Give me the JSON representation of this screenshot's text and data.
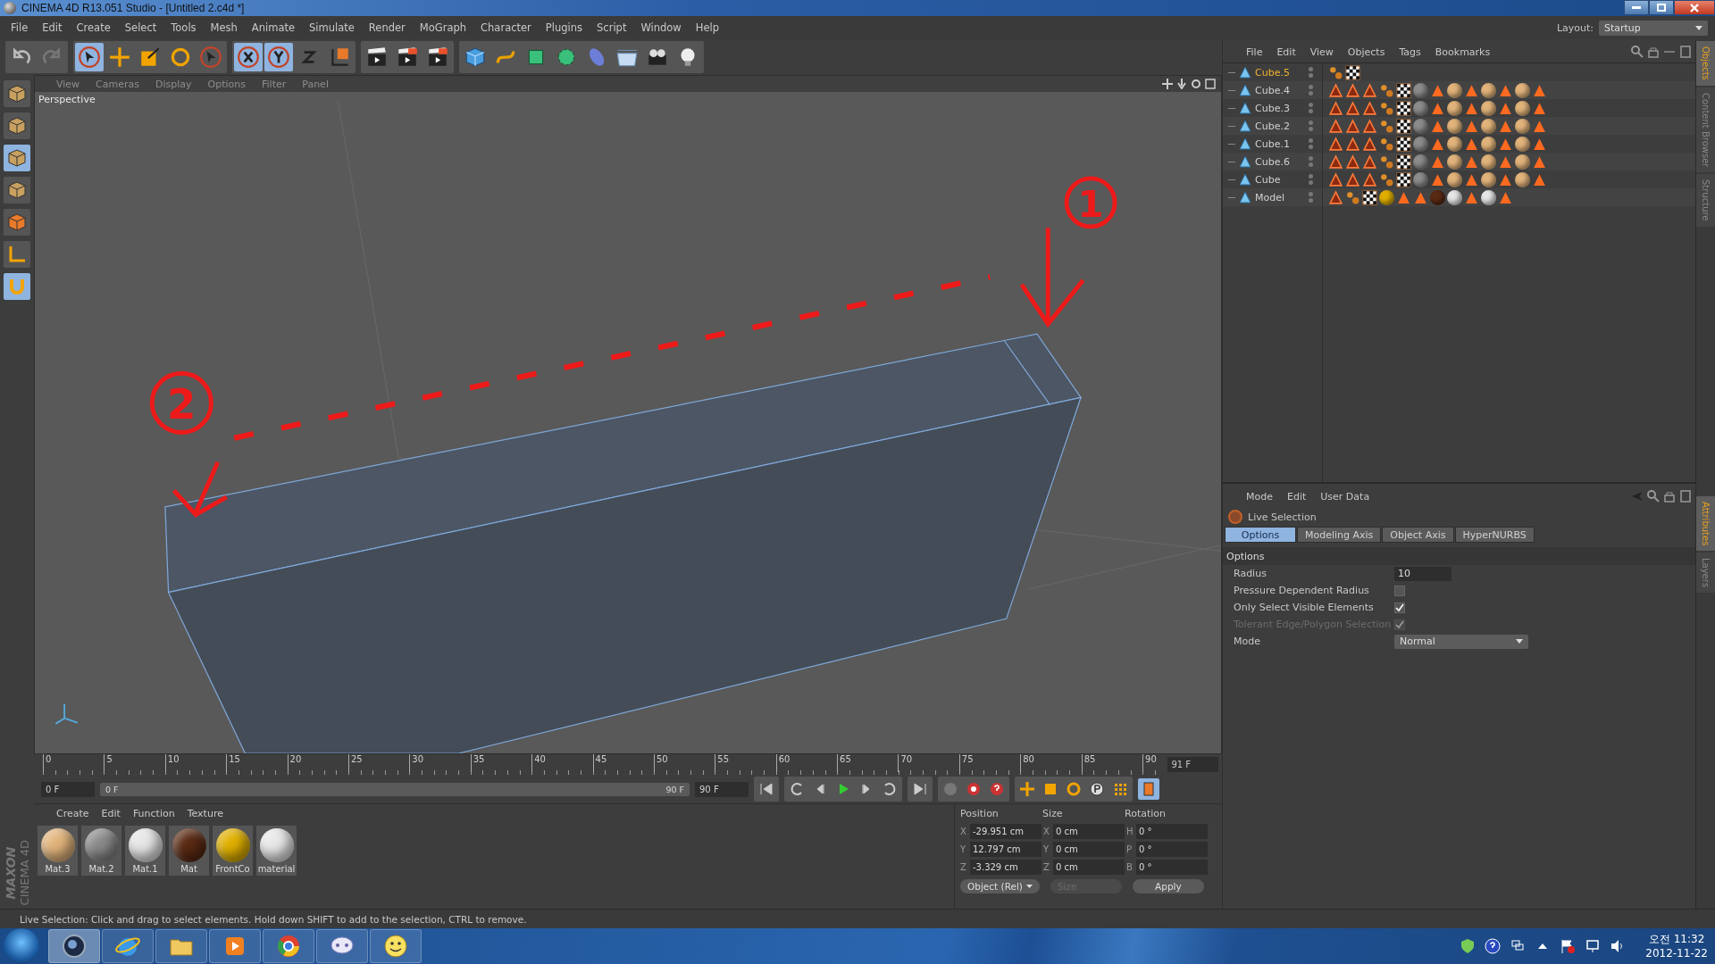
{
  "window": {
    "title": "CINEMA 4D R13.051 Studio - [Untitled 2.c4d *]"
  },
  "menu": [
    "File",
    "Edit",
    "Create",
    "Select",
    "Tools",
    "Mesh",
    "Animate",
    "Simulate",
    "Render",
    "MoGraph",
    "Character",
    "Plugins",
    "Script",
    "Window",
    "Help"
  ],
  "layout": {
    "label": "Layout:",
    "value": "Startup"
  },
  "toolbar": [
    [
      {
        "kind": "undo",
        "selected": false
      },
      {
        "kind": "redo",
        "selected": false
      }
    ],
    [
      {
        "kind": "select",
        "selected": true
      },
      {
        "kind": "move",
        "selected": false
      },
      {
        "kind": "scale",
        "selected": false
      },
      {
        "kind": "rotate",
        "selected": false
      },
      {
        "kind": "recent",
        "selected": false
      }
    ],
    [
      {
        "kind": "x",
        "selected": true
      },
      {
        "kind": "y",
        "selected": true
      },
      {
        "kind": "z",
        "selected": false
      },
      {
        "kind": "coord",
        "selected": false
      }
    ],
    [
      {
        "kind": "render",
        "selected": false
      },
      {
        "kind": "render-view",
        "selected": false
      },
      {
        "kind": "render-settings",
        "selected": false
      }
    ],
    [
      {
        "kind": "cube",
        "selected": false
      },
      {
        "kind": "spline",
        "selected": false
      },
      {
        "kind": "nurbs",
        "selected": false
      },
      {
        "kind": "array",
        "selected": false
      },
      {
        "kind": "deformer",
        "selected": false
      },
      {
        "kind": "floor",
        "selected": false
      },
      {
        "kind": "camera",
        "selected": false
      },
      {
        "kind": "light",
        "selected": false
      }
    ]
  ],
  "viewport": {
    "menu": [
      "View",
      "Cameras",
      "Display",
      "Options",
      "Filter",
      "Panel"
    ],
    "label": "Perspective",
    "annotations": [
      "1",
      "2"
    ]
  },
  "timeline": {
    "ticks": [
      "0",
      "5",
      "10",
      "15",
      "20",
      "25",
      "30",
      "35",
      "40",
      "45",
      "50",
      "55",
      "60",
      "65",
      "70",
      "75",
      "80",
      "85",
      "90"
    ],
    "end_frame": "91 F",
    "start_field": "0 F",
    "range": {
      "start": "0 F",
      "end": "90 F",
      "level": 1
    },
    "end_field": "90 F"
  },
  "materials": {
    "menu": [
      "Create",
      "Edit",
      "Function",
      "Texture"
    ],
    "items": [
      {
        "name": "Mat.3",
        "color": "#e2b47c"
      },
      {
        "name": "Mat.2",
        "color": "#8a8a8a"
      },
      {
        "name": "Mat.1",
        "color": "#e6e6e6"
      },
      {
        "name": "Mat",
        "color": "#5a2a14"
      },
      {
        "name": "FrontCo",
        "color": "#e0b000"
      },
      {
        "name": "material",
        "color": "#e8e8e8"
      }
    ]
  },
  "brand": {
    "company": "MAXON",
    "product": "CINEMA 4D"
  },
  "coordinates": {
    "headers": [
      "Position",
      "Size",
      "Rotation"
    ],
    "rows": [
      {
        "axis": "X",
        "position": "-29.951 cm",
        "size_axis": "X",
        "size": "0 cm",
        "rot_axis": "H",
        "rotation": "0 °"
      },
      {
        "axis": "Y",
        "position": "12.797 cm",
        "size_axis": "Y",
        "size": "0 cm",
        "rot_axis": "P",
        "rotation": "0 °"
      },
      {
        "axis": "Z",
        "position": "-3.329 cm",
        "size_axis": "Z",
        "size": "0 cm",
        "rot_axis": "B",
        "rotation": "0 °"
      }
    ],
    "mode": "Object (Rel)",
    "size_mode": {
      "label": "Size",
      "disabled": true
    },
    "apply": "Apply"
  },
  "objects": {
    "menu": [
      "File",
      "Edit",
      "View",
      "Objects",
      "Tags",
      "Bookmarks"
    ],
    "rows": [
      {
        "name": "Cube.5",
        "selected": true,
        "tags": [
          {
            "kind": "phong"
          },
          {
            "kind": "uvw"
          }
        ]
      },
      {
        "name": "Cube.4",
        "selected": false,
        "tags": [
          {
            "kind": "selection"
          },
          {
            "kind": "selection"
          },
          {
            "kind": "selection"
          },
          {
            "kind": "phong"
          },
          {
            "kind": "uvw"
          },
          {
            "kind": "texture",
            "color": "#8c8c8c"
          },
          {
            "kind": "cone"
          },
          {
            "kind": "texture",
            "color": "#e2b47c"
          },
          {
            "kind": "cone"
          },
          {
            "kind": "texture",
            "color": "#e2b47c"
          },
          {
            "kind": "cone"
          },
          {
            "kind": "texture",
            "color": "#e2b47c"
          },
          {
            "kind": "cone"
          }
        ]
      },
      {
        "name": "Cube.3",
        "selected": false,
        "tags": [
          {
            "kind": "selection"
          },
          {
            "kind": "selection"
          },
          {
            "kind": "selection"
          },
          {
            "kind": "phong"
          },
          {
            "kind": "uvw"
          },
          {
            "kind": "texture",
            "color": "#8c8c8c"
          },
          {
            "kind": "cone"
          },
          {
            "kind": "texture",
            "color": "#e2b47c"
          },
          {
            "kind": "cone"
          },
          {
            "kind": "texture",
            "color": "#e2b47c"
          },
          {
            "kind": "cone"
          },
          {
            "kind": "texture",
            "color": "#e2b47c"
          },
          {
            "kind": "cone"
          }
        ]
      },
      {
        "name": "Cube.2",
        "selected": false,
        "tags": [
          {
            "kind": "selection"
          },
          {
            "kind": "selection"
          },
          {
            "kind": "selection"
          },
          {
            "kind": "phong"
          },
          {
            "kind": "uvw"
          },
          {
            "kind": "texture",
            "color": "#8c8c8c"
          },
          {
            "kind": "cone"
          },
          {
            "kind": "texture",
            "color": "#e2b47c"
          },
          {
            "kind": "cone"
          },
          {
            "kind": "texture",
            "color": "#e2b47c"
          },
          {
            "kind": "cone"
          },
          {
            "kind": "texture",
            "color": "#e2b47c"
          },
          {
            "kind": "cone"
          }
        ]
      },
      {
        "name": "Cube.1",
        "selected": false,
        "tags": [
          {
            "kind": "selection"
          },
          {
            "kind": "selection"
          },
          {
            "kind": "selection"
          },
          {
            "kind": "phong"
          },
          {
            "kind": "uvw"
          },
          {
            "kind": "texture",
            "color": "#8c8c8c"
          },
          {
            "kind": "cone"
          },
          {
            "kind": "texture",
            "color": "#e2b47c"
          },
          {
            "kind": "cone"
          },
          {
            "kind": "texture",
            "color": "#e2b47c"
          },
          {
            "kind": "cone"
          },
          {
            "kind": "texture",
            "color": "#e2b47c"
          },
          {
            "kind": "cone"
          }
        ]
      },
      {
        "name": "Cube.6",
        "selected": false,
        "tags": [
          {
            "kind": "selection"
          },
          {
            "kind": "selection"
          },
          {
            "kind": "selection"
          },
          {
            "kind": "phong"
          },
          {
            "kind": "uvw"
          },
          {
            "kind": "texture",
            "color": "#8c8c8c"
          },
          {
            "kind": "cone"
          },
          {
            "kind": "texture",
            "color": "#e2b47c"
          },
          {
            "kind": "cone"
          },
          {
            "kind": "texture",
            "color": "#e2b47c"
          },
          {
            "kind": "cone"
          },
          {
            "kind": "texture",
            "color": "#e2b47c"
          },
          {
            "kind": "cone"
          }
        ]
      },
      {
        "name": "Cube",
        "selected": false,
        "tags": [
          {
            "kind": "selection"
          },
          {
            "kind": "selection"
          },
          {
            "kind": "selection"
          },
          {
            "kind": "phong"
          },
          {
            "kind": "uvw"
          },
          {
            "kind": "texture",
            "color": "#8c8c8c"
          },
          {
            "kind": "cone"
          },
          {
            "kind": "texture",
            "color": "#e2b47c"
          },
          {
            "kind": "cone"
          },
          {
            "kind": "texture",
            "color": "#e2b47c"
          },
          {
            "kind": "cone"
          },
          {
            "kind": "texture",
            "color": "#e2b47c"
          },
          {
            "kind": "cone"
          }
        ]
      },
      {
        "name": "Model",
        "selected": false,
        "tags": [
          {
            "kind": "selection"
          },
          {
            "kind": "phong"
          },
          {
            "kind": "uvw"
          },
          {
            "kind": "texture",
            "color": "#e0b000"
          },
          {
            "kind": "cone"
          },
          {
            "kind": "cone"
          },
          {
            "kind": "texture",
            "color": "#5a2a14"
          },
          {
            "kind": "texture",
            "color": "#e6e6e6"
          },
          {
            "kind": "cone"
          },
          {
            "kind": "texture",
            "color": "#e6e6e6"
          },
          {
            "kind": "cone"
          }
        ]
      }
    ]
  },
  "side_tabs_top": [
    {
      "label": "Objects",
      "selected": true
    },
    {
      "label": "Content Browser",
      "selected": false
    },
    {
      "label": "Structure",
      "selected": false
    }
  ],
  "attributes": {
    "menu": [
      "Mode",
      "Edit",
      "User Data"
    ],
    "title": "Live Selection",
    "tabs": [
      {
        "label": "Options",
        "selected": true
      },
      {
        "label": "Modeling Axis",
        "selected": false
      },
      {
        "label": "Object Axis",
        "selected": false
      },
      {
        "label": "HyperNURBS",
        "selected": false
      }
    ],
    "section": "Options",
    "fields": [
      {
        "kind": "number",
        "label": "Radius",
        "value": "10"
      },
      {
        "kind": "checkbox",
        "label": "Pressure Dependent Radius",
        "checked": false,
        "disabled": false
      },
      {
        "kind": "checkbox",
        "label": "Only Select Visible Elements",
        "checked": true,
        "disabled": false
      },
      {
        "kind": "checkbox",
        "label": "Tolerant Edge/Polygon Selection",
        "checked": true,
        "disabled": true
      },
      {
        "kind": "dropdown",
        "label": "Mode",
        "value": "Normal"
      }
    ]
  },
  "side_tabs_bottom": [
    {
      "label": "Attributes",
      "selected": true
    },
    {
      "label": "Layers",
      "selected": false
    }
  ],
  "status_bar": "Live Selection: Click and drag to select elements. Hold down SHIFT to add to the selection, CTRL to remove.",
  "taskbar": {
    "apps": [
      {
        "kind": "c4d",
        "selected": true
      },
      {
        "kind": "ie",
        "selected": false
      },
      {
        "kind": "folder",
        "selected": false
      },
      {
        "kind": "media",
        "selected": false
      },
      {
        "kind": "chrome",
        "selected": false
      },
      {
        "kind": "chat",
        "selected": false
      },
      {
        "kind": "face",
        "selected": false
      }
    ],
    "time": "오전 11:32",
    "date": "2012-11-22"
  }
}
